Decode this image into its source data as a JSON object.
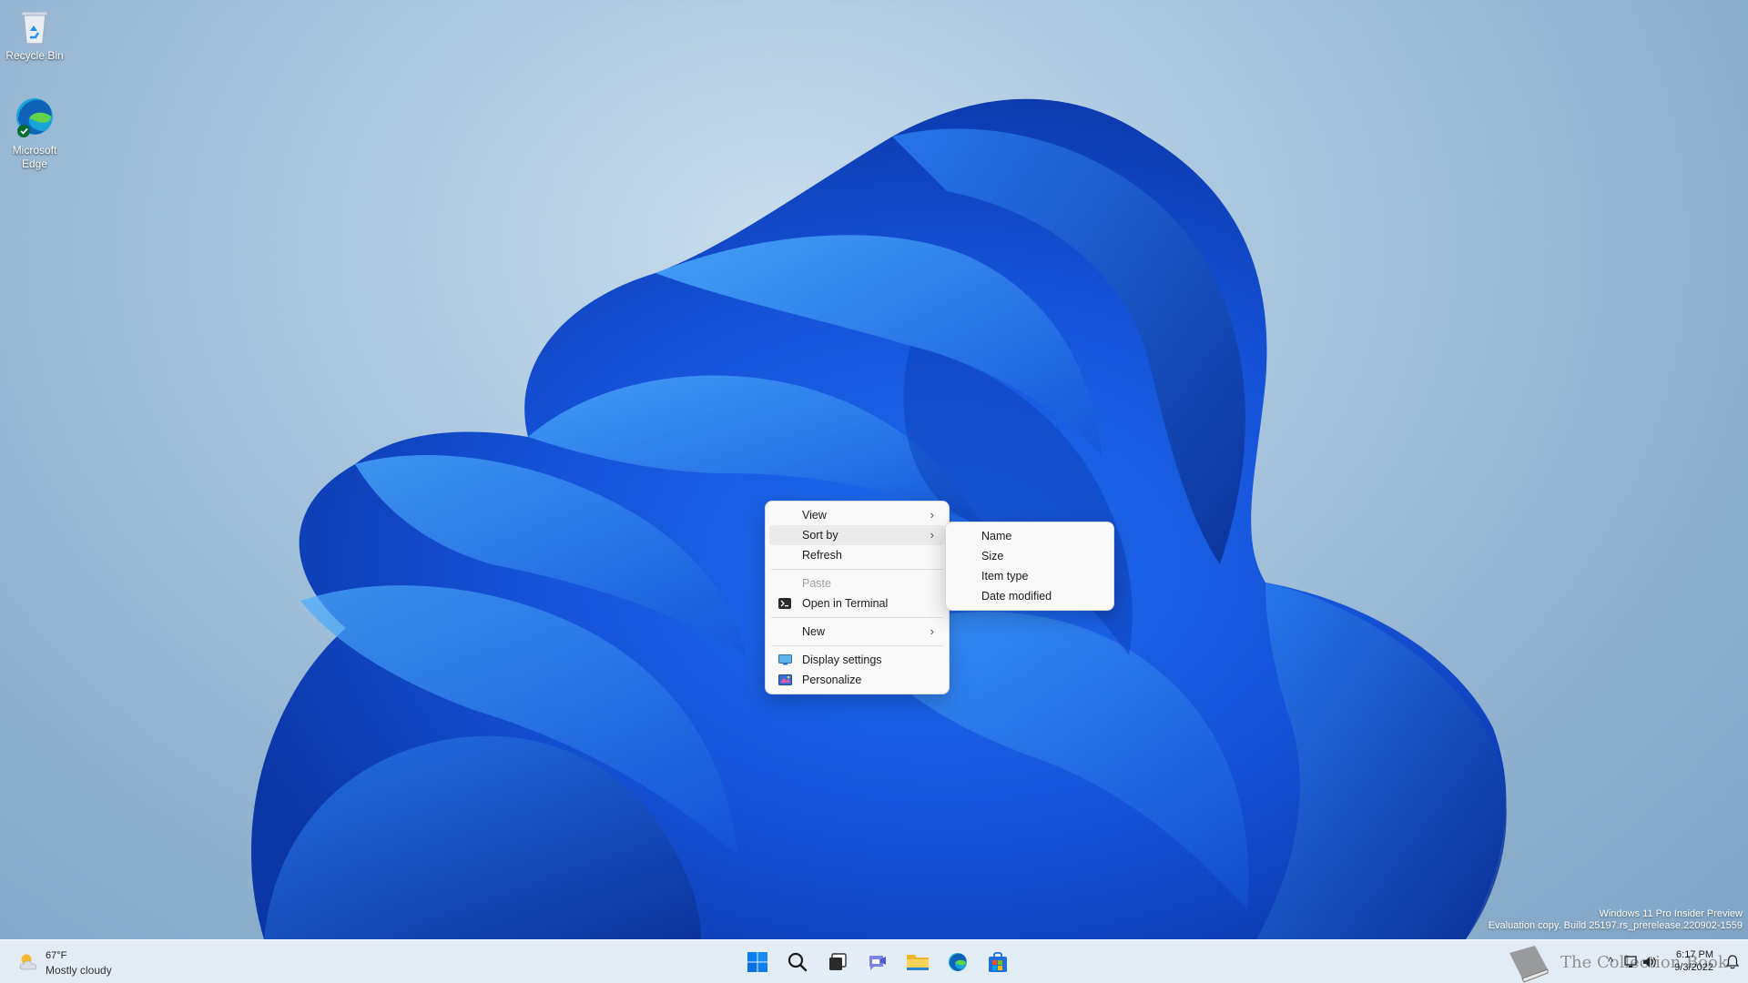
{
  "desktop": {
    "icons": [
      {
        "label": "Recycle Bin"
      },
      {
        "label": "Microsoft Edge"
      }
    ]
  },
  "context_menu": {
    "items": {
      "view": "View",
      "sort_by": "Sort by",
      "refresh": "Refresh",
      "paste": "Paste",
      "open_terminal": "Open in Terminal",
      "new": "New",
      "display_settings": "Display settings",
      "personalize": "Personalize"
    },
    "submenu_arrow": "›"
  },
  "sort_submenu": {
    "items": [
      "Name",
      "Size",
      "Item type",
      "Date modified"
    ]
  },
  "watermark": {
    "line1": "Windows 11 Pro Insider Preview",
    "line2": "Evaluation copy. Build 25197.rs_prerelease.220902-1559"
  },
  "taskbar": {
    "weather": {
      "temp": "67°F",
      "condition": "Mostly cloudy"
    },
    "pinned": [
      "start-icon",
      "search-icon",
      "task-view-icon",
      "chat-icon",
      "file-explorer-icon",
      "edge-icon",
      "store-icon"
    ],
    "tray": {
      "overlay_text": "The Collection Book",
      "time": "6:17 PM",
      "date": "9/3/2022"
    }
  },
  "colors": {
    "accent": "#0067c0",
    "bloom_dark": "#0a3aa8",
    "bloom_light": "#3aa0ff"
  }
}
